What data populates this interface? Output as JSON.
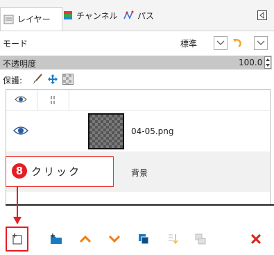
{
  "tabs": {
    "layers_label": "レイヤー",
    "channels_label": "チャンネル",
    "paths_label": "パス"
  },
  "mode": {
    "label": "モード",
    "value": "標準"
  },
  "opacity": {
    "label": "不透明度",
    "value": "100.0"
  },
  "lock": {
    "label": "保護:"
  },
  "layers": [
    {
      "name": "04-05.png",
      "visible": true
    },
    {
      "name": "背景",
      "visible": false
    }
  ],
  "annotation": {
    "step": "8",
    "text": "クリック",
    "color": "#e61d23"
  },
  "colors": {
    "accent_red": "#e61d23",
    "arrow_orange": "#f07d12",
    "layer_blue": "#1a7bc1",
    "delete_red": "#d8281c"
  }
}
